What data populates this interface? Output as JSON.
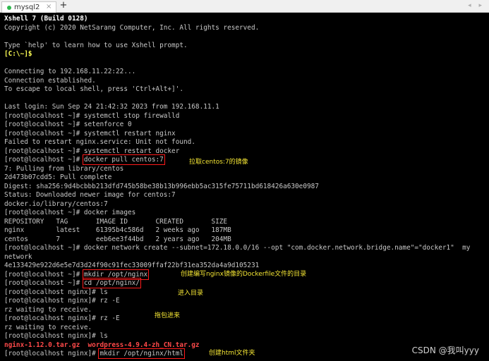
{
  "tabbar": {
    "tab_label": "mysql2",
    "close_glyph": "×",
    "new_tab_glyph": "+",
    "nav_arrows": "◂ ▸"
  },
  "colors": {
    "background": "#000000",
    "text": "#c8c8c8",
    "prompt_yellow": "#ffff55",
    "error_red": "#ff4a4a",
    "highlight_box": "#ff1a1a",
    "annotation": "#f5e634",
    "tab_status": "#2fb84f"
  },
  "icons": {
    "tab_status": "green-dot-icon",
    "tab_close": "close-icon",
    "new_tab": "plus-icon",
    "nav": "chevron-left-right-icon"
  },
  "terminal": {
    "lines": [
      "Xshell 7 (Build 0128)",
      "Copyright (c) 2020 NetSarang Computer, Inc. All rights reserved.",
      "",
      "Type `help' to learn how to use Xshell prompt.",
      "[C:\\~]$",
      "",
      "Connecting to 192.168.11.22:22...",
      "Connection established.",
      "To escape to local shell, press 'Ctrl+Alt+]'.",
      "",
      "Last login: Sun Sep 24 21:42:32 2023 from 192.168.11.1",
      "[root@localhost ~]# systemctl stop firewalld",
      "[root@localhost ~]# setenforce 0",
      "[root@localhost ~]# systemctl restart nginx",
      "Failed to restart nginx.service: Unit not found.",
      "[root@localhost ~]# systemctl restart docker",
      {
        "prompt": "[root@localhost ~]# ",
        "command": "docker pull centos:7"
      },
      "7: Pulling from library/centos",
      "2d473b07cdd5: Pull complete",
      "Digest: sha256:9d4bcbbb213dfd745b58be38b13b996ebb5ac315fe75711bd618426a630e0987",
      "Status: Downloaded newer image for centos:7",
      "docker.io/library/centos:7",
      "[root@localhost ~]# docker images",
      "REPOSITORY   TAG       IMAGE ID       CREATED       SIZE",
      "nginx        latest    61395b4c586d   2 weeks ago   187MB",
      "centos       7         eeb6ee3f44bd   2 years ago   204MB",
      "[root@localhost ~]# docker network create --subnet=172.18.0.0/16 --opt \"com.docker.network.bridge.name\"=\"docker1\"  my",
      "network",
      "4e133429e922d6e5e7d3d24f90c91fec33009ffaf22bf31ea352da4a9d105231",
      {
        "prompt": "[root@localhost ~]# ",
        "command": "mkdir /opt/nginx"
      },
      {
        "prompt": "[root@localhost ~]# ",
        "command": "cd /opt/nginx/"
      },
      "[root@localhost nginx]# ls",
      "[root@localhost nginx]# rz -E",
      "rz waiting to receive.",
      "[root@localhost nginx]# rz -E",
      "rz waiting to receive.",
      "[root@localhost nginx]# ls",
      "nginx-1.12.0.tar.gz  wordpress-4.9.4-zh_CN.tar.gz",
      {
        "prompt": "[root@localhost nginx]# ",
        "command": "mkdir /opt/nginx/html"
      }
    ]
  },
  "annotations": {
    "pull": "拉取centos:7的镜像",
    "mkdir": "创建编写nginx镜像的Dockerfile文件的目录",
    "cd": "进入目录",
    "rz": "拖包进来",
    "html": "创建html文件夹"
  },
  "watermark": "CSDN @我叫yyy"
}
